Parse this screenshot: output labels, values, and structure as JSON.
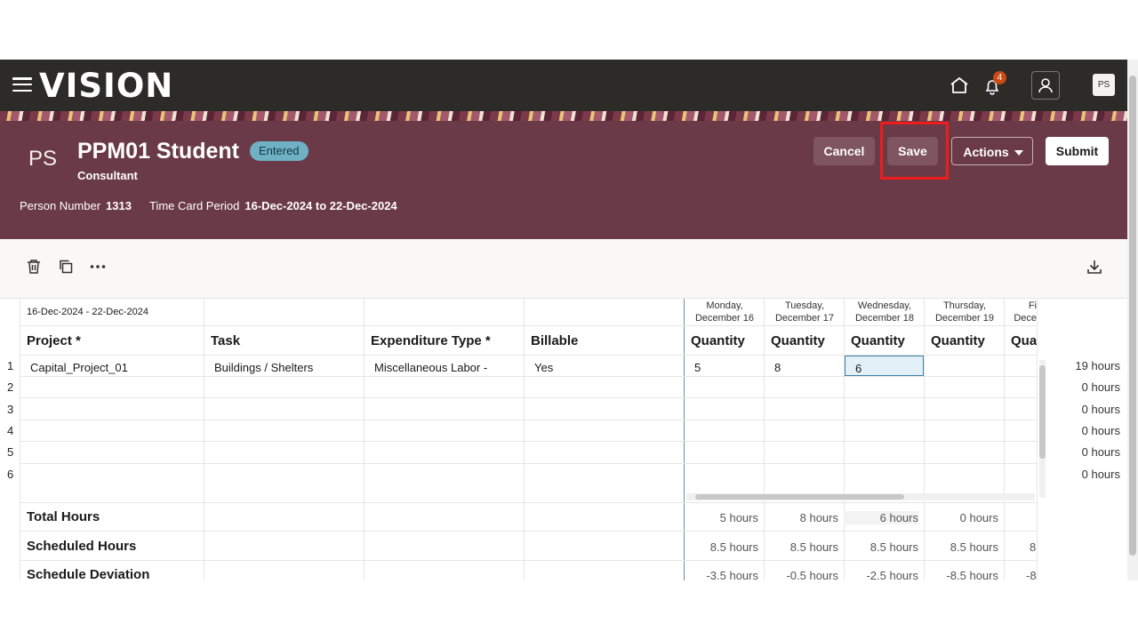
{
  "app": {
    "logo": "VISION",
    "notification_count": "4",
    "user_initials": "PS"
  },
  "header": {
    "initials": "PS",
    "name": "PPM01 Student",
    "status": "Entered",
    "role": "Consultant",
    "person_number_label": "Person Number",
    "person_number": "1313",
    "period_label": "Time Card Period",
    "period": "16-Dec-2024 to 22-Dec-2024",
    "buttons": {
      "cancel": "Cancel",
      "save": "Save",
      "actions": "Actions",
      "submit": "Submit"
    }
  },
  "grid": {
    "range_label": "16-Dec-2024 - 22-Dec-2024",
    "columns": {
      "project": "Project *",
      "task": "Task",
      "expenditure": "Expenditure Type *",
      "billable": "Billable"
    },
    "days": [
      {
        "line1": "Monday,",
        "line2": "December 16",
        "qty_label": "Quantity"
      },
      {
        "line1": "Tuesday,",
        "line2": "December 17",
        "qty_label": "Quantity"
      },
      {
        "line1": "Wednesday,",
        "line2": "December 18",
        "qty_label": "Quantity"
      },
      {
        "line1": "Thursday,",
        "line2": "December 19",
        "qty_label": "Quantity"
      },
      {
        "line1": "Fi",
        "line2": "Dece",
        "qty_label": "Qua"
      }
    ],
    "rows": [
      {
        "num": "1",
        "project": "Capital_Project_01",
        "task": "Buildings / Shelters",
        "expenditure": "Miscellaneous Labor -",
        "billable": "Yes",
        "q1": "5",
        "q2": "8",
        "q3": "6",
        "total": "19 hours"
      },
      {
        "num": "2",
        "total": "0 hours"
      },
      {
        "num": "3",
        "total": "0 hours"
      },
      {
        "num": "4",
        "total": "0 hours"
      },
      {
        "num": "5",
        "total": "0 hours"
      },
      {
        "num": "6",
        "total": "0 hours"
      }
    ],
    "summary": [
      {
        "label": "Total Hours",
        "values": [
          "5 hours",
          "8 hours",
          "6 hours",
          "0 hours",
          ""
        ]
      },
      {
        "label": "Scheduled Hours",
        "values": [
          "8.5 hours",
          "8.5 hours",
          "8.5 hours",
          "8.5 hours",
          "8"
        ]
      },
      {
        "label": "Schedule Deviation",
        "values": [
          "-3.5 hours",
          "-0.5 hours",
          "-2.5 hours",
          "-8.5 hours",
          "-8"
        ]
      }
    ]
  }
}
